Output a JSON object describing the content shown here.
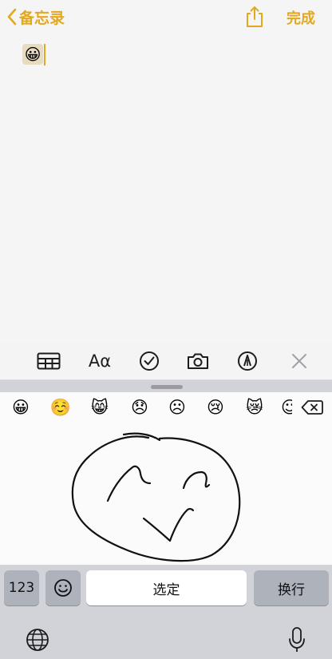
{
  "nav": {
    "back_label": "备忘录",
    "done_label": "完成"
  },
  "note": {
    "content": "😀"
  },
  "toolbar": {
    "format_label": "Aα"
  },
  "emoji_bar": {
    "items": [
      "😀",
      "☺️",
      "😸",
      "😞",
      "☹",
      "😢",
      "😿",
      "☺"
    ]
  },
  "keyboard": {
    "num_label": "123",
    "select_label": "选定",
    "return_label": "换行"
  },
  "colors": {
    "accent": "#E2A91E",
    "key_dark": "#adb2bb",
    "key_light": "#ffffff",
    "kbd_bg": "#d1d3d9"
  }
}
